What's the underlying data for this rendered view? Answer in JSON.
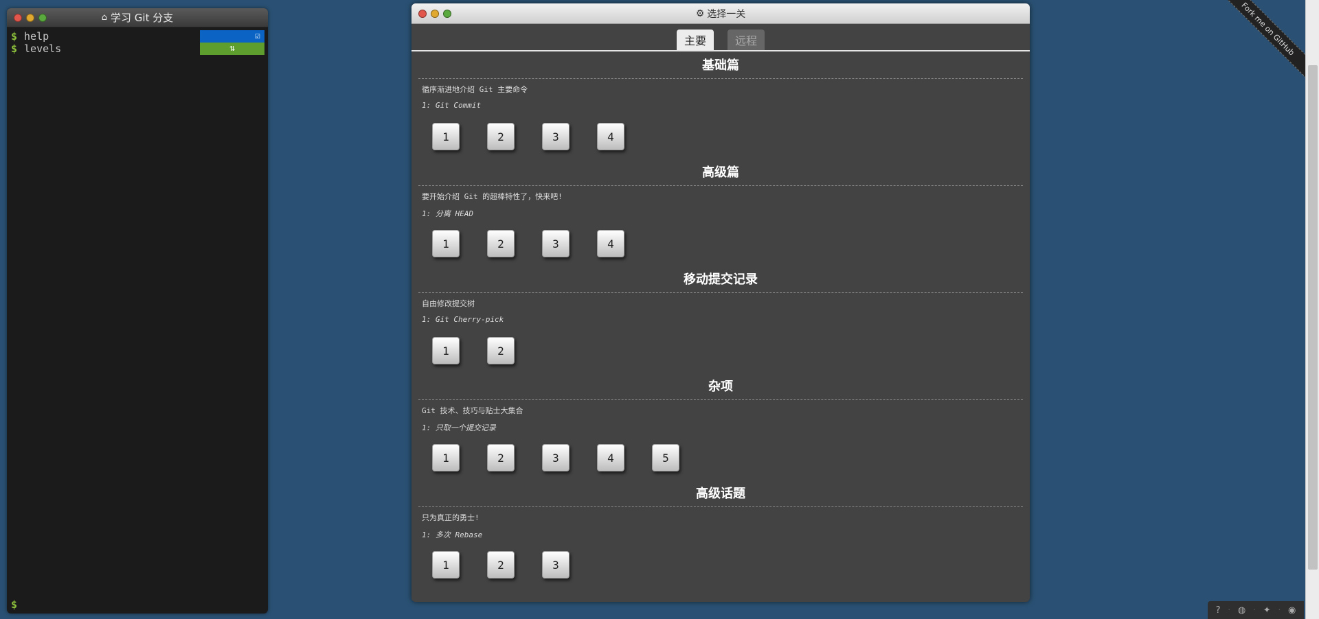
{
  "terminal": {
    "title": "学习 Git 分支",
    "title_icon": "home-icon",
    "prompt": "$",
    "lines": [
      {
        "cmd": "help",
        "badge_icon": "checkbox-icon",
        "badge_color": "#0b63c4"
      },
      {
        "cmd": "levels",
        "badge_icon": "swap-icon",
        "badge_color": "#5d9e2f"
      }
    ]
  },
  "level_window": {
    "title": "选择一关",
    "title_icon": "gear-icon",
    "tabs": [
      {
        "label": "主要",
        "active": true
      },
      {
        "label": "远程",
        "active": false
      }
    ],
    "sections": [
      {
        "title": "基础篇",
        "description": "循序渐进地介绍 Git 主要命令",
        "level_name": "1: Git Commit",
        "buttons": [
          "1",
          "2",
          "3",
          "4"
        ]
      },
      {
        "title": "高级篇",
        "description": "要开始介绍 Git 的超棒特性了，快来吧!",
        "level_name": "1: 分离 HEAD",
        "buttons": [
          "1",
          "2",
          "3",
          "4"
        ]
      },
      {
        "title": "移动提交记录",
        "description": "自由修改提交树",
        "level_name": "1: Git Cherry-pick",
        "buttons": [
          "1",
          "2"
        ]
      },
      {
        "title": "杂项",
        "description": "Git 技术、技巧与贴士大集合",
        "level_name": "1: 只取一个提交记录",
        "buttons": [
          "1",
          "2",
          "3",
          "4",
          "5"
        ]
      },
      {
        "title": "高级话题",
        "description": "只为真正的勇士!",
        "level_name": "1: 多次 Rebase",
        "buttons": [
          "1",
          "2",
          "3"
        ]
      }
    ]
  },
  "ribbon": {
    "label": "Fork me on GitHub"
  },
  "icon_bar": {
    "icons": [
      "help-icon",
      "globe-icon",
      "twitter-icon",
      "github-icon"
    ]
  },
  "colors": {
    "background": "#2a5173",
    "terminal_bg": "#1b1b1b",
    "prompt_green": "#8dc13b",
    "window_bg": "#434343"
  }
}
